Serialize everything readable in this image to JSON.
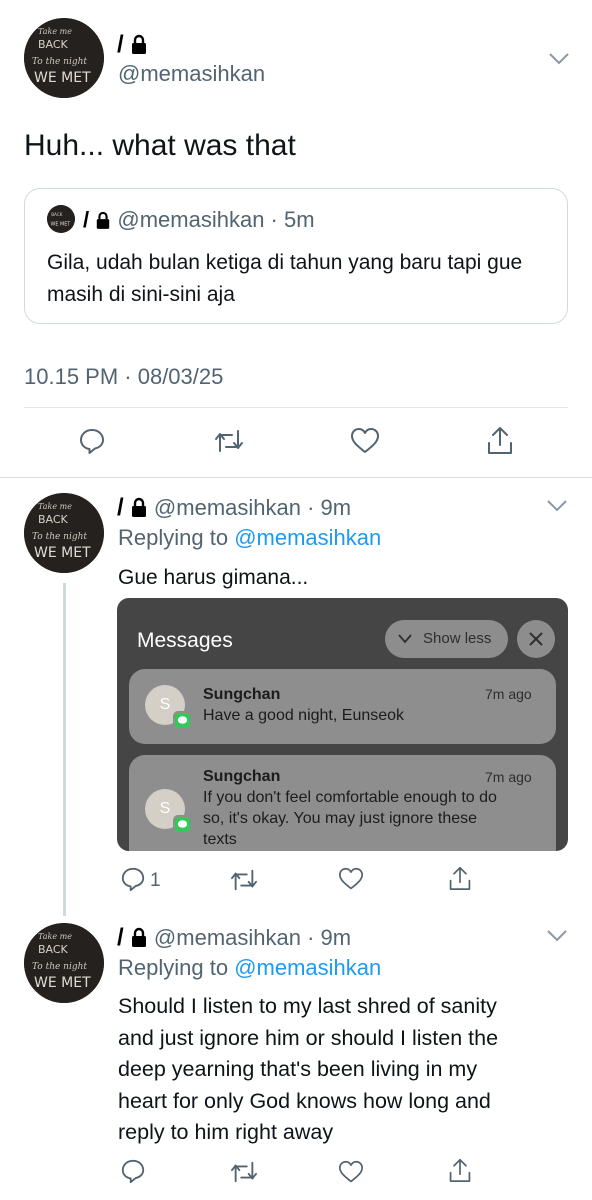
{
  "main_tweet": {
    "name": "/",
    "handle": "@memasihkan",
    "text": "Huh... what was that",
    "quote": {
      "name": "/",
      "handle": "@memasihkan",
      "time": "5m",
      "text": "Gila, udah bulan ketiga di tahun yang baru tapi gue masih di sini-sini aja"
    },
    "timestamp": "10.15 PM · 08/03/25"
  },
  "avatar_text": {
    "line1": "Take me",
    "line2": "BACK",
    "line3": "To the night",
    "line4": "WE MET"
  },
  "reply1": {
    "name": "/",
    "handle": "@memasihkan",
    "time": "9m",
    "replying_prefix": "Replying to",
    "replying_to": "@memasihkan",
    "text": "Gue harus gimana...",
    "reply_count": "1",
    "notification": {
      "title": "Messages",
      "show_less": "Show less",
      "items": [
        {
          "initial": "S",
          "sender": "Sungchan",
          "time": "7m ago",
          "text": "Have a good night, Eunseok"
        },
        {
          "initial": "S",
          "sender": "Sungchan",
          "time": "7m ago",
          "text_line1": "If you don't feel comfortable enough to do",
          "text_line2": "so, it's okay. You may just ignore these",
          "text_line3": "texts"
        }
      ]
    }
  },
  "reply2": {
    "name": "/",
    "handle": "@memasihkan",
    "time": "9m",
    "replying_prefix": "Replying to",
    "replying_to": "@memasihkan",
    "text_line1": "Should I listen to my last shred of sanity",
    "text_line2": "and just ignore him or should I listen the",
    "text_line3": "deep yearning that's been living in my",
    "text_line4": "heart for only God knows how long and",
    "text_line5": "reply to him right away"
  },
  "icons": [
    "lock-icon",
    "chevron-down-icon",
    "reply-icon",
    "retweet-icon",
    "like-icon",
    "share-icon",
    "close-icon",
    "messages-app-icon"
  ]
}
